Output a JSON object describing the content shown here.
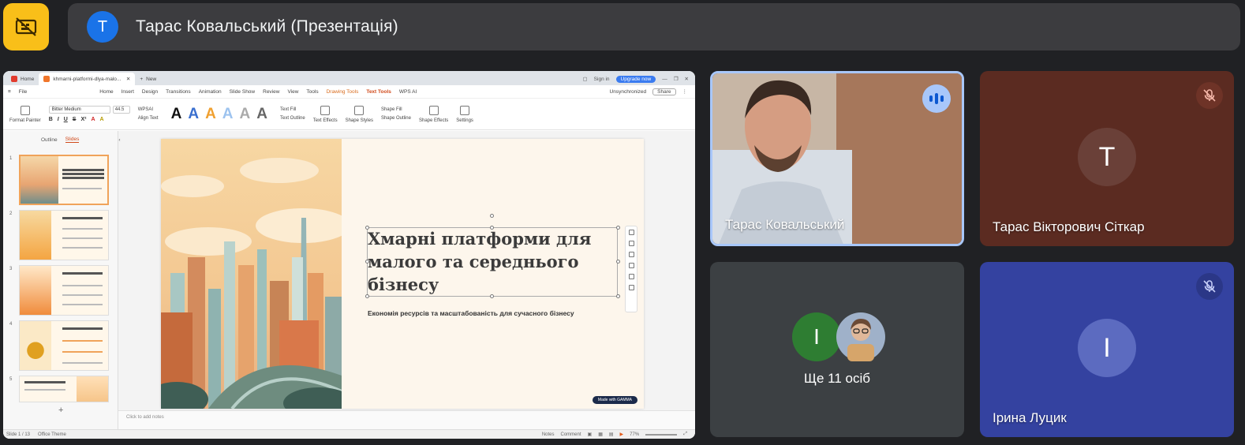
{
  "presentation_bar": {
    "avatar_letter": "T",
    "title": "Тарас Ковальський (Презентація)"
  },
  "app": {
    "tabs": [
      {
        "label": "Home"
      },
      {
        "label": "khmarni-platformi-dlya-malo..."
      },
      {
        "label": "New"
      }
    ],
    "sign_in": "Sign in",
    "upgrade": "Upgrade now",
    "menu": [
      "Home",
      "Insert",
      "Design",
      "Transitions",
      "Animation",
      "Slide Show",
      "Review",
      "View",
      "Tools",
      "Drawing Tools",
      "Text Tools",
      "WPS AI"
    ],
    "file_label": "File",
    "unsync": "Unsynchronized",
    "share": "Share",
    "ribbon": {
      "format_painter": "Format Painter",
      "font_name": "Bitter Medium",
      "font_size": "44.5",
      "wps_ai": "WPSAI",
      "align_text": "Align Text",
      "text_fill": "Text Fill",
      "text_outline": "Text Outline",
      "text_effects": "Text Effects",
      "shape_styles": "Shape Styles",
      "shape_fill": "Shape Fill",
      "shape_outline": "Shape Outline",
      "shape_effects": "Shape Effects",
      "settings": "Settings",
      "wordart_glyph": "A"
    },
    "panel_tabs": [
      "Outline",
      "Slides"
    ],
    "slide_numbers": [
      "1",
      "2",
      "3",
      "4",
      "5"
    ],
    "slide": {
      "title": "Хмарні платформи для малого та середнього бізнесу",
      "subtitle": "Економія ресурсів та масштабованість для сучасного бізнесу",
      "made_with": "Made with GAMMA"
    },
    "notes_placeholder": "Click to add notes",
    "status": {
      "slide_of": "Slide 1 / 13",
      "theme": "Office Theme",
      "notes": "Notes",
      "comment": "Comment",
      "zoom": "77%"
    }
  },
  "participants": [
    {
      "name": "Тарас Ковальський",
      "speaking": true
    },
    {
      "name": "Тарас Вікторович Сіткар",
      "avatar_letter": "T",
      "muted": true,
      "bg": "#5b2b21"
    },
    {
      "avatar_letter": "I",
      "others_label": "Ще 11 осіб"
    },
    {
      "name": "Ірина Луцик",
      "avatar_letter": "I",
      "muted": true,
      "bg": "#3442a0"
    }
  ],
  "colors": {
    "meet_bg": "#202124",
    "camera_off_button": "#f9bf19",
    "presenter_avatar": "#1a73e8",
    "speaking_ring": "#a8c7fa"
  }
}
